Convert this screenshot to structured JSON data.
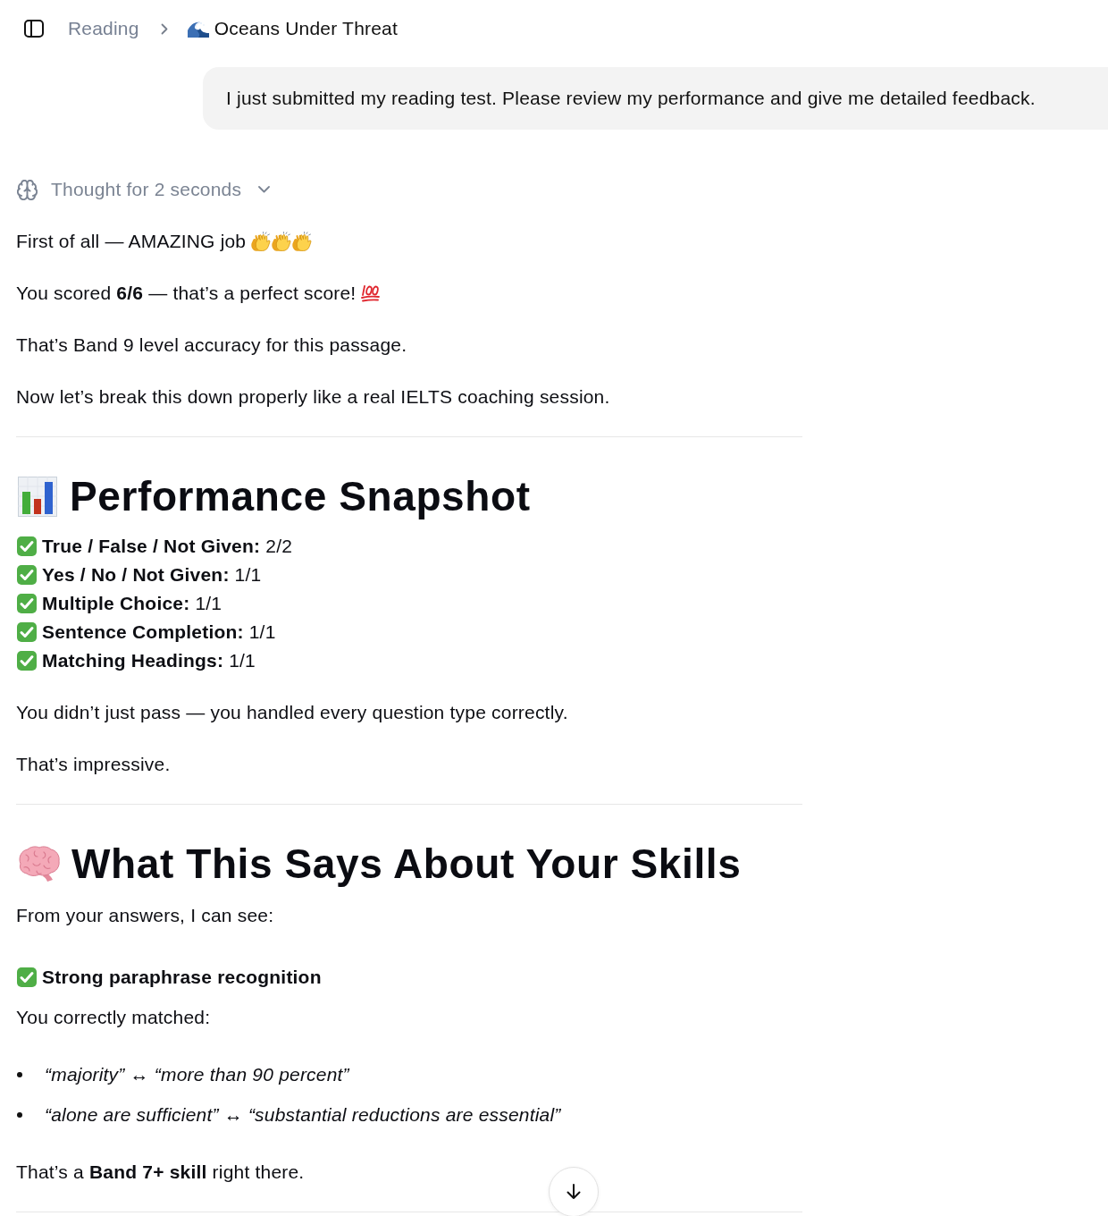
{
  "breadcrumb": {
    "parent": "Reading",
    "current": "Oceans Under Threat"
  },
  "user_message": {
    "text": "I just submitted my reading test. Please review my performance and give me detailed feedback."
  },
  "thought": {
    "label": "Thought for 2 seconds",
    "expanded": false
  },
  "blocks": [
    {
      "kind": "cheer",
      "text": "First of all — AMAZING job"
    },
    {
      "kind": "score",
      "text": "You scored **6/6** — that’s a perfect score!"
    },
    {
      "kind": "paragraph",
      "text": "That’s Band 9 level accuracy for this passage."
    },
    {
      "kind": "paragraph",
      "text": "Now let’s break this down properly like a real IELTS coaching session."
    },
    {
      "kind": "divider"
    },
    {
      "kind": "chart-heading",
      "text": "Performance Snapshot"
    },
    {
      "kind": "checklist",
      "items": [
        {
          "text": "**True / False / Not Given:** 2/2",
          "correct": true
        },
        {
          "text": "**Yes / No / Not Given:** 1/1",
          "correct": true
        },
        {
          "text": "**Multiple Choice:** 1/1",
          "correct": true
        },
        {
          "text": "**Sentence Completion:** 1/1",
          "correct": true
        },
        {
          "text": "**Matching Headings:** 1/1",
          "correct": true
        }
      ]
    },
    {
      "kind": "paragraph",
      "text": "You didn’t just pass — you handled every question type correctly."
    },
    {
      "kind": "paragraph",
      "text": "That’s impressive."
    },
    {
      "kind": "divider"
    },
    {
      "kind": "brain-heading",
      "text": "What This Says About Your Skills"
    },
    {
      "kind": "paragraph",
      "text": "From your answers, I can see:"
    },
    {
      "kind": "check",
      "text": "Strong paraphrase recognition",
      "correct": true
    },
    {
      "kind": "paragraph",
      "text": "You correctly matched:"
    },
    {
      "kind": "bullets",
      "items": [
        "“majority” ↔ “more than 90 percent”",
        "“alone are sufficient” ↔ “substantial reductions are essential”"
      ]
    },
    {
      "kind": "paragraph",
      "text": "That’s a **Band 7+ skill** right there."
    },
    {
      "kind": "divider"
    }
  ],
  "scroll_button": {
    "visible": true
  }
}
